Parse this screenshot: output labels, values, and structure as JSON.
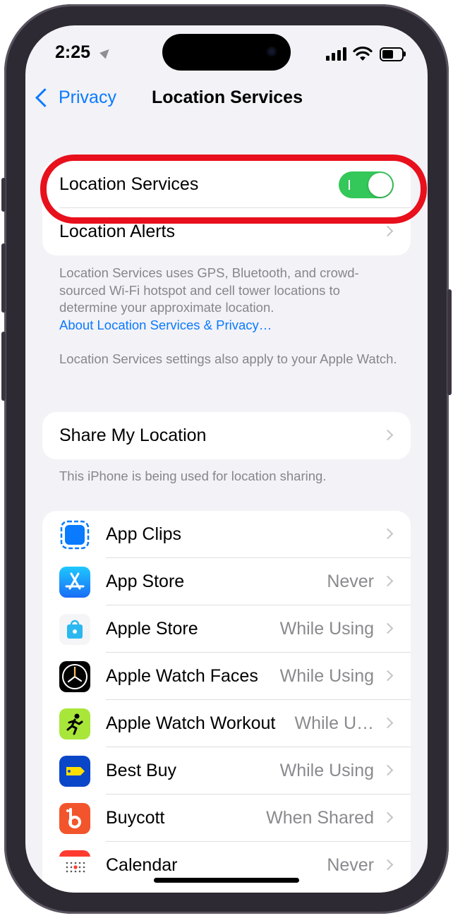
{
  "status_bar": {
    "time": "2:25"
  },
  "nav": {
    "back_label": "Privacy",
    "title": "Location Services"
  },
  "top_group": {
    "location_services_label": "Location Services",
    "location_services_on": true,
    "location_alerts_label": "Location Alerts"
  },
  "description": {
    "text": "Location Services uses GPS, Bluetooth, and crowd-sourced Wi-Fi hotspot and cell tower locations to determine your approximate location.",
    "link": "About Location Services & Privacy…",
    "watch_note": "Location Services settings also apply to your Apple Watch."
  },
  "share": {
    "label": "Share My Location",
    "footer": "This iPhone is being used for location sharing."
  },
  "apps": [
    {
      "name": "App Clips",
      "value": "",
      "icon": "app-clips-icon",
      "color": "#0a7aff"
    },
    {
      "name": "App Store",
      "value": "Never",
      "icon": "app-store-icon",
      "color": "#1a8cff"
    },
    {
      "name": "Apple Store",
      "value": "While Using",
      "icon": "apple-store-icon",
      "color": "#2bb8f0"
    },
    {
      "name": "Apple Watch Faces",
      "value": "While Using",
      "icon": "watch-faces-icon",
      "color": "#000000"
    },
    {
      "name": "Apple Watch Workout",
      "value": "While U…",
      "icon": "workout-icon",
      "color": "#a8e63a"
    },
    {
      "name": "Best Buy",
      "value": "While Using",
      "icon": "best-buy-icon",
      "color": "#0a46c8"
    },
    {
      "name": "Buycott",
      "value": "When Shared",
      "icon": "buycott-icon",
      "color": "#f2552c"
    },
    {
      "name": "Calendar",
      "value": "Never",
      "icon": "calendar-icon",
      "color": "#ffffff"
    }
  ]
}
